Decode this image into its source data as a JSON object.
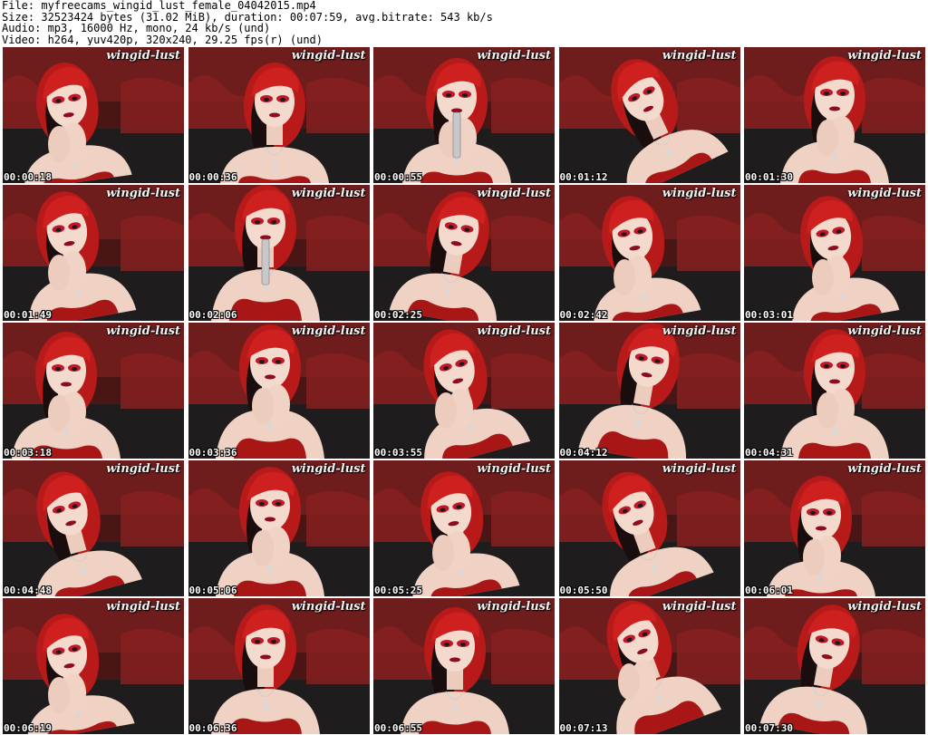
{
  "header": {
    "lines": [
      "File: myfreecams_wingid_lust_female_04042015.mp4",
      "Size: 32523424 bytes (31.02 MiB), duration: 00:07:59, avg.bitrate: 543 kb/s",
      "Audio: mp3, 16000 Hz, mono, 24 kb/s (und)",
      "Video: h264, yuv420p, 320x240, 29.25 fps(r) (und)"
    ]
  },
  "thumbnails": [
    {
      "time": "00:00:18",
      "watermark": "wingid-lust"
    },
    {
      "time": "00:00:36",
      "watermark": "wingid-lust"
    },
    {
      "time": "00:00:55",
      "watermark": "wingid-lust"
    },
    {
      "time": "00:01:12",
      "watermark": "wingid-lust"
    },
    {
      "time": "00:01:30",
      "watermark": "wingid-lust"
    },
    {
      "time": "00:01:49",
      "watermark": "wingid-lust"
    },
    {
      "time": "00:02:06",
      "watermark": "wingid-lust"
    },
    {
      "time": "00:02:25",
      "watermark": "wingid-lust"
    },
    {
      "time": "00:02:42",
      "watermark": "wingid-lust"
    },
    {
      "time": "00:03:01",
      "watermark": "wingid-lust"
    },
    {
      "time": "00:03:18",
      "watermark": "wingid-lust"
    },
    {
      "time": "00:03:36",
      "watermark": "wingid-lust"
    },
    {
      "time": "00:03:55",
      "watermark": "wingid-lust"
    },
    {
      "time": "00:04:12",
      "watermark": "wingid-lust"
    },
    {
      "time": "00:04:31",
      "watermark": "wingid-lust"
    },
    {
      "time": "00:04:48",
      "watermark": "wingid-lust"
    },
    {
      "time": "00:05:06",
      "watermark": "wingid-lust"
    },
    {
      "time": "00:05:25",
      "watermark": "wingid-lust"
    },
    {
      "time": "00:05:50",
      "watermark": "wingid-lust"
    },
    {
      "time": "00:06:01",
      "watermark": "wingid-lust"
    },
    {
      "time": "00:06:19",
      "watermark": "wingid-lust"
    },
    {
      "time": "00:06:36",
      "watermark": "wingid-lust"
    },
    {
      "time": "00:06:55",
      "watermark": "wingid-lust"
    },
    {
      "time": "00:07:13",
      "watermark": "wingid-lust"
    },
    {
      "time": "00:07:30",
      "watermark": "wingid-lust"
    }
  ],
  "colors": {
    "background": "#ffffff",
    "hair": "#c81e1e",
    "dress": "#b01818",
    "skin": "#f1d6c8",
    "backdrop": "#5a1a1a",
    "timestamp": "#ffffff"
  }
}
